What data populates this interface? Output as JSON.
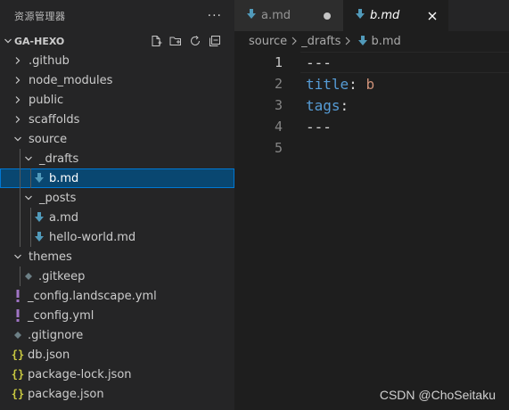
{
  "sidebar": {
    "title": "资源管理器",
    "more": "···",
    "project": "GA-HEXO",
    "tree": [
      {
        "label": ".github",
        "icon": "chevron-right-icon",
        "indent": 0,
        "kind": "folder-closed"
      },
      {
        "label": "node_modules",
        "icon": "chevron-right-icon",
        "indent": 0,
        "kind": "folder-closed"
      },
      {
        "label": "public",
        "icon": "chevron-right-icon",
        "indent": 0,
        "kind": "folder-closed"
      },
      {
        "label": "scaffolds",
        "icon": "chevron-right-icon",
        "indent": 0,
        "kind": "folder-closed"
      },
      {
        "label": "source",
        "icon": "chevron-down-icon",
        "indent": 0,
        "kind": "folder-open"
      },
      {
        "label": "_drafts",
        "icon": "chevron-down-icon",
        "indent": 1,
        "kind": "folder-open"
      },
      {
        "label": "b.md",
        "icon": "markdown-icon",
        "indent": 2,
        "kind": "file",
        "selected": true
      },
      {
        "label": "_posts",
        "icon": "chevron-down-icon",
        "indent": 1,
        "kind": "folder-open"
      },
      {
        "label": "a.md",
        "icon": "markdown-icon",
        "indent": 2,
        "kind": "file"
      },
      {
        "label": "hello-world.md",
        "icon": "markdown-icon",
        "indent": 2,
        "kind": "file"
      },
      {
        "label": "themes",
        "icon": "chevron-down-icon",
        "indent": 0,
        "kind": "folder-open"
      },
      {
        "label": ".gitkeep",
        "icon": "diamond-icon",
        "indent": 1,
        "kind": "file"
      },
      {
        "label": "_config.landscape.yml",
        "icon": "yaml-icon",
        "indent": 0,
        "kind": "file"
      },
      {
        "label": "_config.yml",
        "icon": "yaml-icon",
        "indent": 0,
        "kind": "file"
      },
      {
        "label": ".gitignore",
        "icon": "diamond-icon",
        "indent": 0,
        "kind": "file"
      },
      {
        "label": "db.json",
        "icon": "json-icon",
        "indent": 0,
        "kind": "file"
      },
      {
        "label": "package-lock.json",
        "icon": "json-icon",
        "indent": 0,
        "kind": "file"
      },
      {
        "label": "package.json",
        "icon": "json-icon",
        "indent": 0,
        "kind": "file"
      }
    ]
  },
  "tabs": [
    {
      "label": "a.md",
      "active": false,
      "modified": true
    },
    {
      "label": "b.md",
      "active": true,
      "modified": false
    }
  ],
  "breadcrumb": [
    "source",
    "_drafts",
    "b.md"
  ],
  "editor": {
    "lines": [
      {
        "num": "1",
        "tokens": [
          {
            "t": "---",
            "c": "tok-dash"
          }
        ]
      },
      {
        "num": "2",
        "tokens": [
          {
            "t": "title",
            "c": "tok-key"
          },
          {
            "t": ": ",
            "c": "tok-punc"
          },
          {
            "t": "b",
            "c": "tok-str"
          }
        ]
      },
      {
        "num": "3",
        "tokens": [
          {
            "t": "tags",
            "c": "tok-key"
          },
          {
            "t": ":",
            "c": "tok-punc"
          }
        ]
      },
      {
        "num": "4",
        "tokens": [
          {
            "t": "---",
            "c": "tok-dash"
          }
        ]
      },
      {
        "num": "5",
        "tokens": []
      }
    ],
    "current_line": "1"
  },
  "watermark": "CSDN @ChoSeitaku",
  "colors": {
    "markdown": "#519aba",
    "yaml": "#a074c4",
    "json": "#cbcb41",
    "gitfile": "#6d8086"
  }
}
